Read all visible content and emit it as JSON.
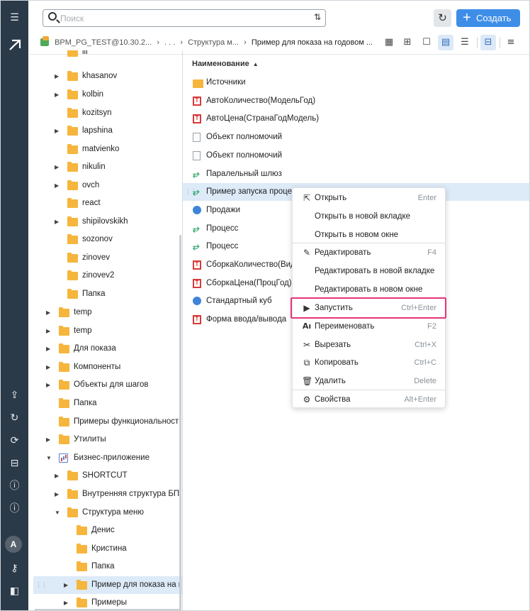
{
  "search": {
    "placeholder": "Поиск"
  },
  "create_label": "Создать",
  "breadcrumb": {
    "connection": "BPM_PG_TEST@10.30.2...",
    "ellipsis": ". . .",
    "folder": "Структура м...",
    "current": "Пример для показа на годовом ..."
  },
  "list": {
    "column_header": "Наименование",
    "items": [
      {
        "label": "Источники",
        "icon": "folder-icon"
      },
      {
        "label": "АвтоКоличество(МодельГод)",
        "icon": "table-icon"
      },
      {
        "label": "АвтоЦена(СтранаГодМодель)",
        "icon": "table-icon"
      },
      {
        "label": "Объект полномочий",
        "icon": "document-icon"
      },
      {
        "label": "Объект полномочий",
        "icon": "document-icon"
      },
      {
        "label": "Паралельный шлюз",
        "icon": "process-icon"
      },
      {
        "label": "Пример запуска процес",
        "icon": "process-icon"
      },
      {
        "label": "Продажи",
        "icon": "cube-icon"
      },
      {
        "label": "Процесс",
        "icon": "process-icon"
      },
      {
        "label": "Процесс",
        "icon": "process-icon"
      },
      {
        "label": "СборкаКоличество(Вид",
        "icon": "table-icon"
      },
      {
        "label": "СборкаЦена(ПроцГод)",
        "icon": "table-icon"
      },
      {
        "label": "Стандартный куб",
        "icon": "cube-icon"
      },
      {
        "label": "Форма ввода/вывода",
        "icon": "table-icon"
      }
    ]
  },
  "tree": [
    {
      "label": "ill"
    },
    {
      "label": "khasanov"
    },
    {
      "label": "kolbin"
    },
    {
      "label": "kozitsyn"
    },
    {
      "label": "lapshina"
    },
    {
      "label": "matvienko"
    },
    {
      "label": "nikulin"
    },
    {
      "label": "ovch"
    },
    {
      "label": "react"
    },
    {
      "label": "shipilovskikh"
    },
    {
      "label": "sozonov"
    },
    {
      "label": "zinovev"
    },
    {
      "label": "zinovev2"
    },
    {
      "label": "Папка"
    },
    {
      "label": "temp"
    },
    {
      "label": "temp"
    },
    {
      "label": "Для показа"
    },
    {
      "label": "Компоненты"
    },
    {
      "label": "Объекты для шагов"
    },
    {
      "label": "Папка"
    },
    {
      "label": "Примеры функциональност"
    },
    {
      "label": "Утилиты"
    },
    {
      "label": "Бизнес-приложение"
    },
    {
      "label": "SHORTCUT"
    },
    {
      "label": "Внутренняя структура БП"
    },
    {
      "label": "Структура меню"
    },
    {
      "label": "Денис"
    },
    {
      "label": "Кристина"
    },
    {
      "label": "Папка"
    },
    {
      "label": "Пример для показа на г"
    },
    {
      "label": "Примеры"
    }
  ],
  "context_menu": [
    {
      "label": "Открыть",
      "shortcut": "Enter",
      "icon": "open-external-icon"
    },
    {
      "label": "Открыть в новой вкладке",
      "shortcut": ""
    },
    {
      "label": "Открыть в новом окне",
      "shortcut": ""
    },
    {
      "label": "Редактировать",
      "shortcut": "F4",
      "icon": "pencil-icon"
    },
    {
      "label": "Редактировать в новой вкладке",
      "shortcut": ""
    },
    {
      "label": "Редактировать в новом окне",
      "shortcut": ""
    },
    {
      "label": "Запустить",
      "shortcut": "Ctrl+Enter",
      "icon": "run-icon"
    },
    {
      "label": "Переименовать",
      "shortcut": "F2",
      "icon": "rename-icon"
    },
    {
      "label": "Вырезать",
      "shortcut": "Ctrl+X",
      "icon": "scissors-icon"
    },
    {
      "label": "Копировать",
      "shortcut": "Ctrl+C",
      "icon": "copy-icon"
    },
    {
      "label": "Удалить",
      "shortcut": "Delete",
      "icon": "trash-icon"
    },
    {
      "label": "Свойства",
      "shortcut": "Alt+Enter",
      "icon": "properties-icon"
    }
  ],
  "user_avatar": "A",
  "colors": {
    "sidebar": "#2b3a48",
    "accent": "#3e8ee8",
    "highlight": "#e6357a",
    "folder": "#f6b53c",
    "selection": "#ddeaf8"
  }
}
